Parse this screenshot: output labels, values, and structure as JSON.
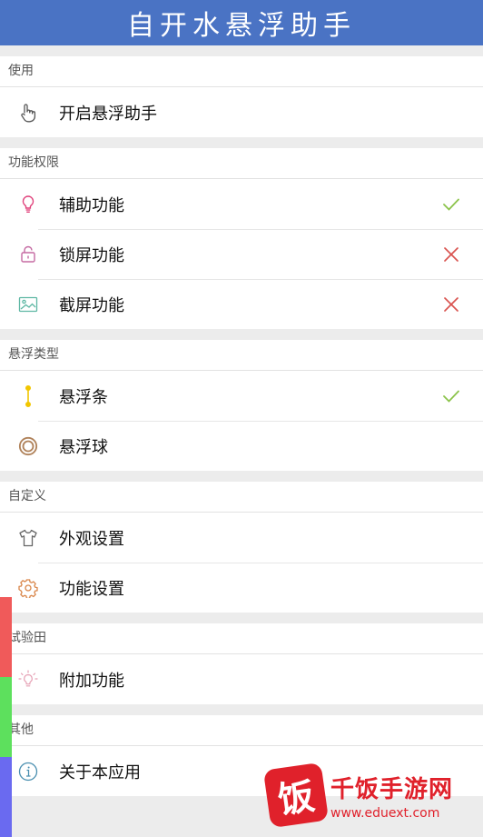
{
  "app": {
    "title": "自开水悬浮助手"
  },
  "sections": [
    {
      "header": "使用",
      "items": [
        {
          "label": "开启悬浮助手",
          "icon": "hand-pointer-icon",
          "status": null
        }
      ]
    },
    {
      "header": "功能权限",
      "items": [
        {
          "label": "辅助功能",
          "icon": "lightbulb-icon",
          "status": "check"
        },
        {
          "label": "锁屏功能",
          "icon": "lock-icon",
          "status": "cross"
        },
        {
          "label": "截屏功能",
          "icon": "image-icon",
          "status": "cross"
        }
      ]
    },
    {
      "header": "悬浮类型",
      "items": [
        {
          "label": "悬浮条",
          "icon": "float-bar-icon",
          "status": "check"
        },
        {
          "label": "悬浮球",
          "icon": "float-ball-icon",
          "status": null
        }
      ]
    },
    {
      "header": "自定义",
      "items": [
        {
          "label": "外观设置",
          "icon": "shirt-icon",
          "status": null
        },
        {
          "label": "功能设置",
          "icon": "gear-icon",
          "status": null
        }
      ]
    },
    {
      "header": "试验田",
      "items": [
        {
          "label": "附加功能",
          "icon": "lightbulb-glow-icon",
          "status": null
        }
      ]
    },
    {
      "header": "其他",
      "items": [
        {
          "label": "关于本应用",
          "icon": "info-icon",
          "status": null
        }
      ]
    }
  ],
  "watermark": {
    "logo": "饭",
    "name": "千饭手游网",
    "url": "www.eduext.com"
  },
  "colors": {
    "titlebar": "#4a73c4",
    "check": "#8bc34a",
    "cross": "#d9534f",
    "side_red": "#f05a5a",
    "side_green": "#5de05d",
    "side_blue": "#6a6af0"
  }
}
